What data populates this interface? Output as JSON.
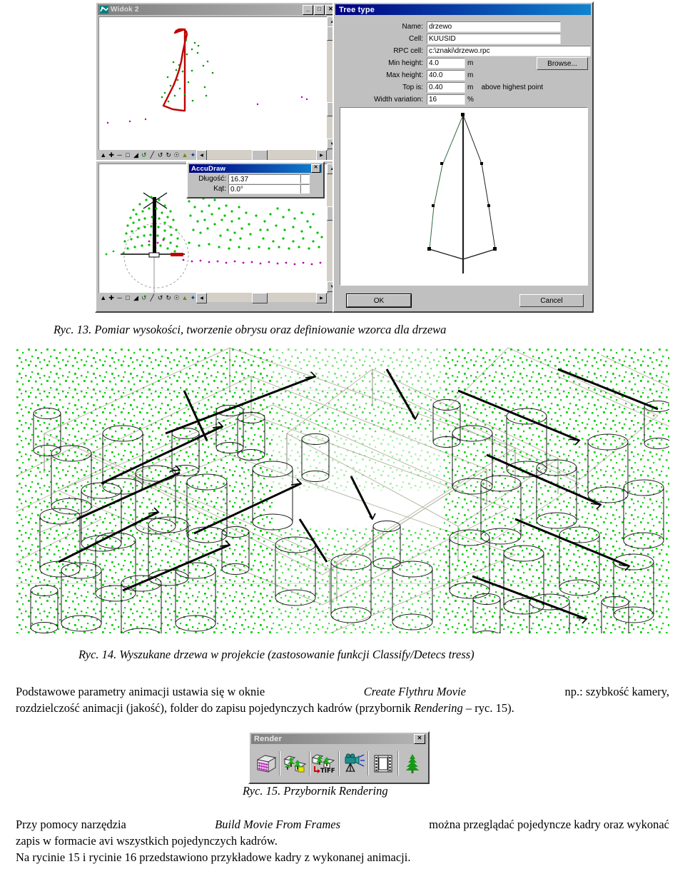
{
  "figure13": {
    "view_window": {
      "title": "Widok 2",
      "buttons": {
        "minimize": "_",
        "maximize": "□",
        "close": "✕"
      }
    },
    "accudraw": {
      "title": "AccuDraw",
      "close": "✕",
      "fields": [
        {
          "label": "Długość:",
          "value": "16.37"
        },
        {
          "label": "Kąt:",
          "value": "0.0°"
        }
      ]
    },
    "tree_dialog": {
      "title": "Tree type",
      "fields": [
        {
          "label": "Name:",
          "value": "drzewo",
          "unit": ""
        },
        {
          "label": "Cell:",
          "value": "KUUSID",
          "unit": ""
        },
        {
          "label": "RPC cell:",
          "value": "c:\\znaki\\drzewo.rpc",
          "unit": ""
        },
        {
          "label": "Min height:",
          "value": "4.0",
          "unit": "m"
        },
        {
          "label": "Max height:",
          "value": "40.0",
          "unit": "m"
        },
        {
          "label": "Top is:",
          "value": "0.40",
          "unit": "m    above highest point"
        },
        {
          "label": "Width variation:",
          "value": "16",
          "unit": "%"
        }
      ],
      "browse_label": "Browse...",
      "ok_label": "OK",
      "cancel_label": "Cancel"
    },
    "caption": "Ryc. 13. Pomiar wysokości, tworzenie obrysu oraz definiowanie wzorca dla drzewa"
  },
  "figure14": {
    "caption": "Ryc. 14. Wyszukane drzewa w projekcie (zastosowanie funkcji Classify/Detecs tress)"
  },
  "body": {
    "paragraph1_line1_a": "Podstawowe parametry animacji ustawia się w oknie ",
    "paragraph1_line1_i": "Create Flythru Movie",
    "paragraph1_line1_b": " np.: szybkość kamery,",
    "paragraph1_line2_a": "rozdzielczość animacji (jakość), folder do zapisu pojedynczych kadrów (przybornik ",
    "paragraph1_line2_i": "Rendering",
    "paragraph1_line2_b": " – ryc. 15).",
    "paragraph2_a": "Przy pomocy narzędzia ",
    "paragraph2_i": "Build Movie From Frames",
    "paragraph2_b": " można przeglądać pojedyncze kadry oraz wykonać",
    "paragraph2_line2": "zapis w formacie avi wszystkich pojedynczych kadrów.",
    "paragraph3": "Na rycinie 15 i rycinie 16 przedstawiono przykładowe kadry z wykonanej animacji."
  },
  "figure15": {
    "toolbar_title": "Render",
    "close": "✕",
    "icons": [
      "render-wireframe-cube-icon",
      "render-scene-icon",
      "save-image-tiff-icon",
      "camera-flythru-icon",
      "film-strip-movie-icon",
      "tree-rpc-icon"
    ],
    "caption": "Ryc. 15. Przybornik Rendering"
  }
}
